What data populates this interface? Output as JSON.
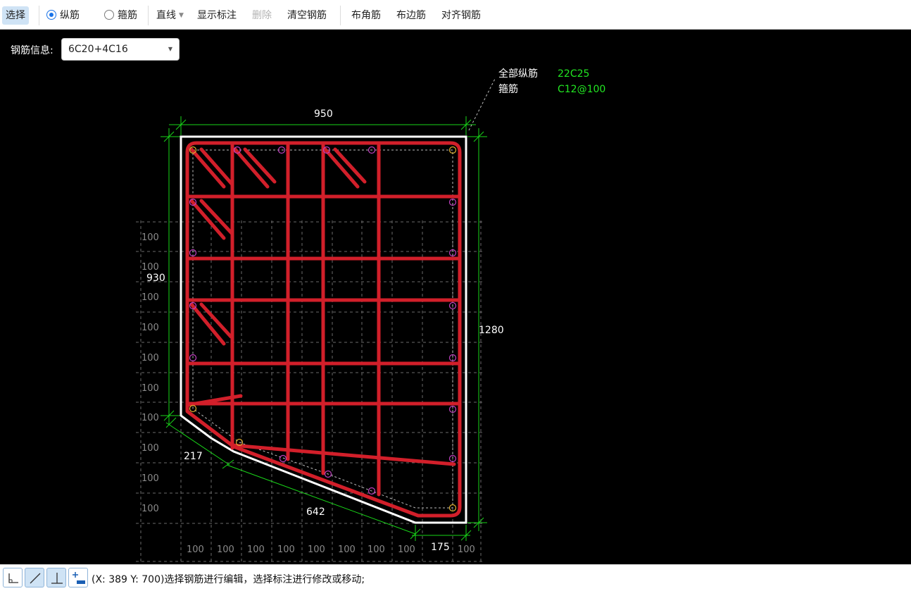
{
  "toolbar": {
    "select_label": "选择",
    "longitudinal_label": "纵筋",
    "stirrup_label": "箍筋",
    "line_mode_label": "直线",
    "show_annotation_label": "显示标注",
    "delete_label": "删除",
    "clear_rebar_label": "清空钢筋",
    "corner_rebar_label": "布角筋",
    "edge_rebar_label": "布边筋",
    "align_rebar_label": "对齐钢筋"
  },
  "rebar_info": {
    "label": "钢筋信息:",
    "value": "6C20+4C16"
  },
  "legend": {
    "all_longitudinal_label": "全部纵筋",
    "all_longitudinal_value": "22C25",
    "stirrup_label": "箍筋",
    "stirrup_value": "C12@100"
  },
  "dimensions": {
    "top_width": "950",
    "left_height": "930",
    "right_height": "1280",
    "chamfer_small": "217",
    "chamfer_long": "642",
    "bottom_width": "175"
  },
  "grid": {
    "spacing_label": "100"
  },
  "status": {
    "text": "(X: 389 Y: 700)选择钢筋进行编辑，选择标注进行修改或移动;"
  },
  "colors": {
    "rebar": "#d21f2a",
    "dimension": "#19d619",
    "outline": "#ffffff",
    "legend_value": "#22e622",
    "active_button": "#cfe3f5",
    "radio_accent": "#1a73e8"
  }
}
